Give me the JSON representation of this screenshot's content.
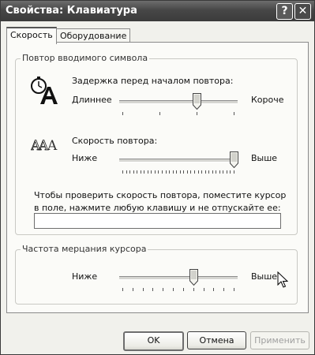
{
  "window": {
    "title": "Свойства: Клавиатура",
    "help_glyph": "?",
    "close_glyph": "✕"
  },
  "tabs": [
    {
      "label": "Скорость",
      "active": true
    },
    {
      "label": "Оборудование",
      "active": false
    }
  ],
  "repeat_group": {
    "legend": "Повтор вводимого символа",
    "delay": {
      "label": "Задержка перед началом повтора:",
      "left_label": "Длиннее",
      "right_label": "Короче",
      "icon": "stopwatch-letter-a-icon",
      "tick_count": 4,
      "value_fraction": 0.67
    },
    "rate": {
      "label": "Скорость повтора:",
      "left_label": "Ниже",
      "right_label": "Выше",
      "icon": "repeated-letters-a-icon",
      "tick_count": 32,
      "value_fraction": 1.0
    },
    "test_text": "Чтобы проверить скорость повтора, поместите курсор в поле, нажмите любую клавишу и не отпускайте ее:",
    "test_value": ""
  },
  "cursor_group": {
    "legend": "Частота мерцания курсора",
    "left_label": "Ниже",
    "right_label": "Выше",
    "tick_count": 12,
    "value_fraction": 0.64
  },
  "buttons": {
    "ok": "OK",
    "cancel": "Отмена",
    "apply": "Применить"
  }
}
